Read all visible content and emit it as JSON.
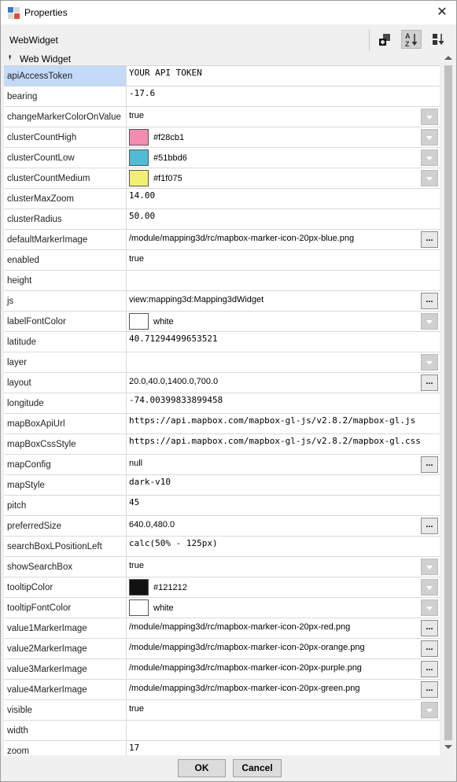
{
  "window": {
    "title": "Properties",
    "close_glyph": "✕"
  },
  "toolbar": {
    "object_name": "WebWidget",
    "buttons": [
      {
        "icon": "add-slot-icon"
      },
      {
        "icon": "sort-az-icon",
        "active": true
      },
      {
        "icon": "sort-order-icon"
      }
    ]
  },
  "section": {
    "caret": "⯭",
    "label": "Web Widget"
  },
  "properties": [
    {
      "name": "apiAccessToken",
      "value": "YOUR API TOKEN",
      "kind": "mono",
      "selected": true
    },
    {
      "name": "bearing",
      "value": "-17.6",
      "kind": "mono"
    },
    {
      "name": "changeMarkerColorOnValue",
      "value": "true",
      "kind": "dropdown"
    },
    {
      "name": "clusterCountHigh",
      "value": "#f28cb1",
      "kind": "color",
      "color": "#f28cb1",
      "control": "dropdown"
    },
    {
      "name": "clusterCountLow",
      "value": "#51bbd6",
      "kind": "color",
      "color": "#51bbd6",
      "control": "dropdown"
    },
    {
      "name": "clusterCountMedium",
      "value": "#f1f075",
      "kind": "color",
      "color": "#f1f075",
      "control": "dropdown"
    },
    {
      "name": "clusterMaxZoom",
      "value": "14.00",
      "kind": "mono"
    },
    {
      "name": "clusterRadius",
      "value": "50.00",
      "kind": "mono"
    },
    {
      "name": "defaultMarkerImage",
      "value": "/module/mapping3d/rc/mapbox-marker-icon-20px-blue.png",
      "kind": "ellipsis"
    },
    {
      "name": "enabled",
      "value": "true",
      "kind": "text"
    },
    {
      "name": "height",
      "value": "",
      "kind": "text"
    },
    {
      "name": "js",
      "value": "view:mapping3d:Mapping3dWidget",
      "kind": "ellipsis"
    },
    {
      "name": "labelFontColor",
      "value": "white",
      "kind": "color",
      "color": "#ffffff",
      "control": "dropdown"
    },
    {
      "name": "latitude",
      "value": "40.71294499653521",
      "kind": "mono"
    },
    {
      "name": "layer",
      "value": "",
      "kind": "dropdown"
    },
    {
      "name": "layout",
      "value": "20.0,40.0,1400.0,700.0",
      "kind": "ellipsis"
    },
    {
      "name": "longitude",
      "value": "-74.00399833899458",
      "kind": "mono"
    },
    {
      "name": "mapBoxApiUrl",
      "value": "https://api.mapbox.com/mapbox-gl-js/v2.8.2/mapbox-gl.js",
      "kind": "mono"
    },
    {
      "name": "mapBoxCssStyle",
      "value": "https://api.mapbox.com/mapbox-gl-js/v2.8.2/mapbox-gl.css",
      "kind": "mono"
    },
    {
      "name": "mapConfig",
      "value": "null",
      "kind": "ellipsis"
    },
    {
      "name": "mapStyle",
      "value": "dark-v10",
      "kind": "mono"
    },
    {
      "name": "pitch",
      "value": "45",
      "kind": "mono"
    },
    {
      "name": "preferredSize",
      "value": "640.0,480.0",
      "kind": "ellipsis"
    },
    {
      "name": "searchBoxLPositionLeft",
      "value": "calc(50% - 125px)",
      "kind": "mono"
    },
    {
      "name": "showSearchBox",
      "value": "true",
      "kind": "dropdown"
    },
    {
      "name": "tooltipColor",
      "value": "#121212",
      "kind": "color",
      "color": "#121212",
      "control": "dropdown"
    },
    {
      "name": "tooltipFontColor",
      "value": "white",
      "kind": "color",
      "color": "#ffffff",
      "control": "dropdown"
    },
    {
      "name": "value1MarkerImage",
      "value": "/module/mapping3d/rc/mapbox-marker-icon-20px-red.png",
      "kind": "ellipsis"
    },
    {
      "name": "value2MarkerImage",
      "value": "/module/mapping3d/rc/mapbox-marker-icon-20px-orange.png",
      "kind": "ellipsis"
    },
    {
      "name": "value3MarkerImage",
      "value": "/module/mapping3d/rc/mapbox-marker-icon-20px-purple.png",
      "kind": "ellipsis"
    },
    {
      "name": "value4MarkerImage",
      "value": "/module/mapping3d/rc/mapbox-marker-icon-20px-green.png",
      "kind": "ellipsis"
    },
    {
      "name": "visible",
      "value": "true",
      "kind": "dropdown"
    },
    {
      "name": "width",
      "value": "",
      "kind": "text"
    },
    {
      "name": "zoom",
      "value": "17",
      "kind": "mono"
    }
  ],
  "ellipsis_label": "...",
  "footer": {
    "ok_label": "OK",
    "cancel_label": "Cancel"
  }
}
